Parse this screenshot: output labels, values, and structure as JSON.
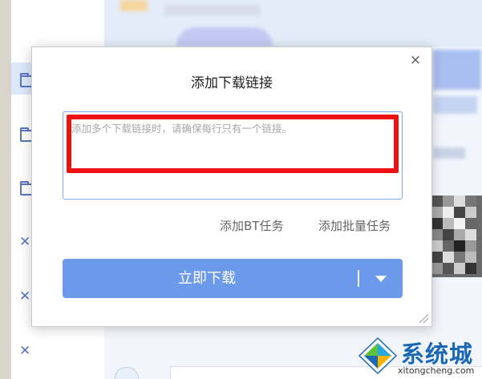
{
  "dialog": {
    "title": "添加下载链接",
    "close_label": "×",
    "input_placeholder": "添加多个下载链接时，请确保每行只有一个链接。",
    "input_value": "",
    "add_bt_task": "添加BT任务",
    "add_batch_task": "添加批量任务",
    "download_now": "立即下载"
  },
  "watermark": {
    "brand": "系统城",
    "domain": "xitongcheng.com"
  },
  "icons": {
    "close": "close-icon",
    "dropdown": "caret-down-icon",
    "resize": "resize-grip-icon",
    "sidebar_folder": "folder-icon",
    "sidebar_delete": "close-icon"
  },
  "colors": {
    "primary_button": "#6a9ae9",
    "highlight": "#ee1111",
    "input_border": "#7fa5e6",
    "watermark_text": "#1a67b3"
  }
}
